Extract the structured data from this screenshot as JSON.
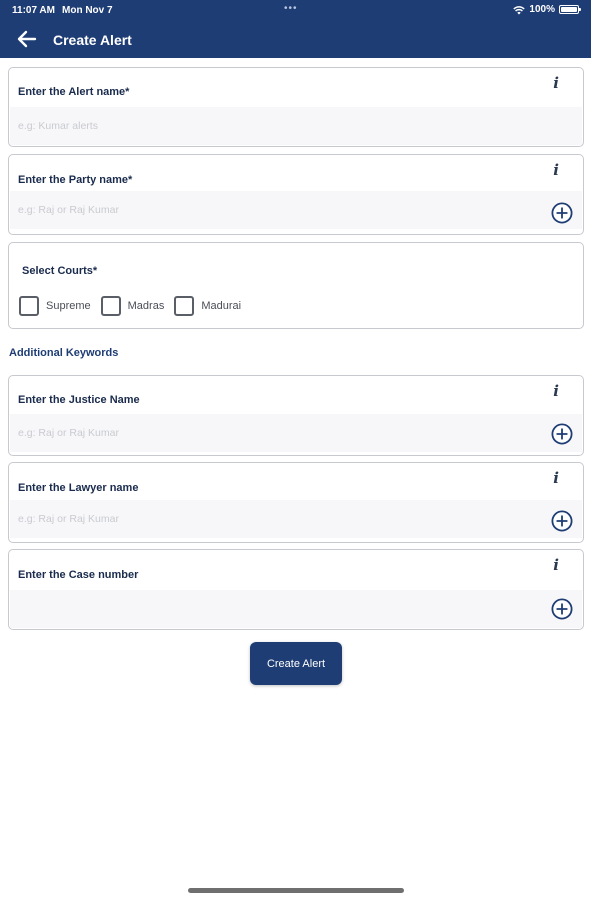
{
  "status_bar": {
    "time": "11:07 AM",
    "date": "Mon Nov 7",
    "dots": "•••",
    "battery": "100%"
  },
  "header": {
    "title": "Create Alert",
    "back_icon": "arrow-left-icon"
  },
  "form": {
    "alert_name": {
      "label": "Enter the Alert name*",
      "placeholder": "e.g: Kumar alerts",
      "value": ""
    },
    "party_name": {
      "label": "Enter the Party name*",
      "placeholder": "e.g: Raj or Raj Kumar",
      "value": ""
    },
    "courts": {
      "label": "Select Courts*",
      "options": [
        {
          "label": "Supreme",
          "checked": false
        },
        {
          "label": "Madras",
          "checked": false
        },
        {
          "label": "Madurai",
          "checked": false
        }
      ]
    },
    "additional_heading": "Additional Keywords",
    "justice_name": {
      "label": "Enter the Justice Name",
      "placeholder": "e.g: Raj or Raj Kumar",
      "value": ""
    },
    "lawyer_name": {
      "label": "Enter the Lawyer name",
      "placeholder": "e.g: Raj or Raj Kumar",
      "value": ""
    },
    "case_number": {
      "label": "Enter the Case number",
      "placeholder": "",
      "value": ""
    },
    "info_glyph": "i"
  },
  "actions": {
    "create_label": "Create Alert"
  },
  "colors": {
    "primary": "#1e3d74",
    "label_text": "#1a2b4d",
    "input_bg": "#f7f7f9",
    "border": "#c6c9ce"
  }
}
